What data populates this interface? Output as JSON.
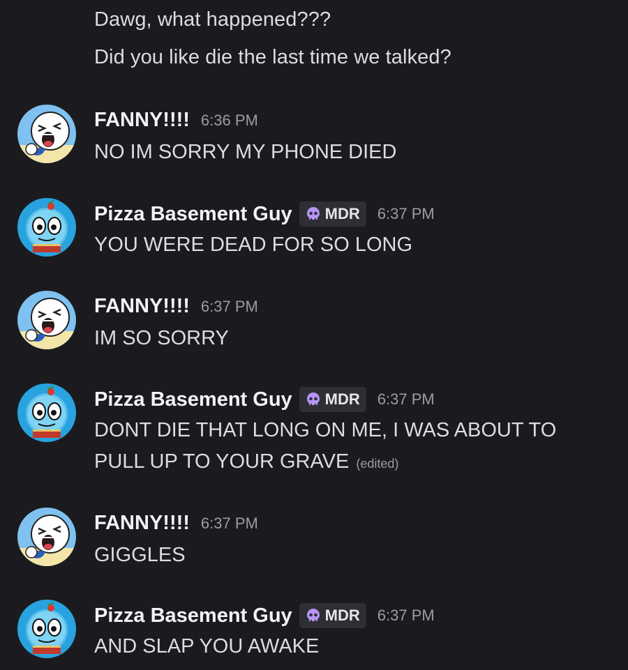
{
  "continued_lines": [
    "Dawg, what happened???",
    "Did you like die the last time we talked?"
  ],
  "messages": [
    {
      "author": "FANNY!!!!",
      "avatar": "fanny-avatar",
      "tag": "",
      "time": "6:36 PM",
      "lines": [
        "NO IM SORRY MY PHONE DIED"
      ],
      "edited": ""
    },
    {
      "author": "Pizza Basement Guy",
      "avatar": "pizza-avatar",
      "tag": "MDR",
      "time": "6:37 PM",
      "lines": [
        "YOU WERE DEAD FOR SO LONG"
      ],
      "edited": ""
    },
    {
      "author": "FANNY!!!!",
      "avatar": "fanny-avatar",
      "tag": "",
      "time": "6:37 PM",
      "lines": [
        "IM SO SORRY"
      ],
      "edited": ""
    },
    {
      "author": "Pizza Basement Guy",
      "avatar": "pizza-avatar",
      "tag": "MDR",
      "time": "6:37 PM",
      "lines": [
        "DONT DIE THAT LONG ON ME, I WAS ABOUT TO",
        "PULL UP TO YOUR GRAVE"
      ],
      "edited": "(edited)"
    },
    {
      "author": "FANNY!!!!",
      "avatar": "fanny-avatar",
      "tag": "",
      "time": "6:37 PM",
      "lines": [
        "GIGGLES"
      ],
      "edited": ""
    },
    {
      "author": "Pizza Basement Guy",
      "avatar": "pizza-avatar",
      "tag": "MDR",
      "time": "6:37 PM",
      "lines": [
        "AND SLAP YOU AWAKE"
      ],
      "edited": ""
    }
  ],
  "colors": {
    "background": "#1b1b1f",
    "text": "#dcdde1",
    "username": "#f2f3f5",
    "timestamp": "#9b9ca4",
    "tag_bg": "#2e2f35",
    "skull": "#b794f6"
  },
  "icons": {
    "tag_icon": "skull-icon"
  }
}
